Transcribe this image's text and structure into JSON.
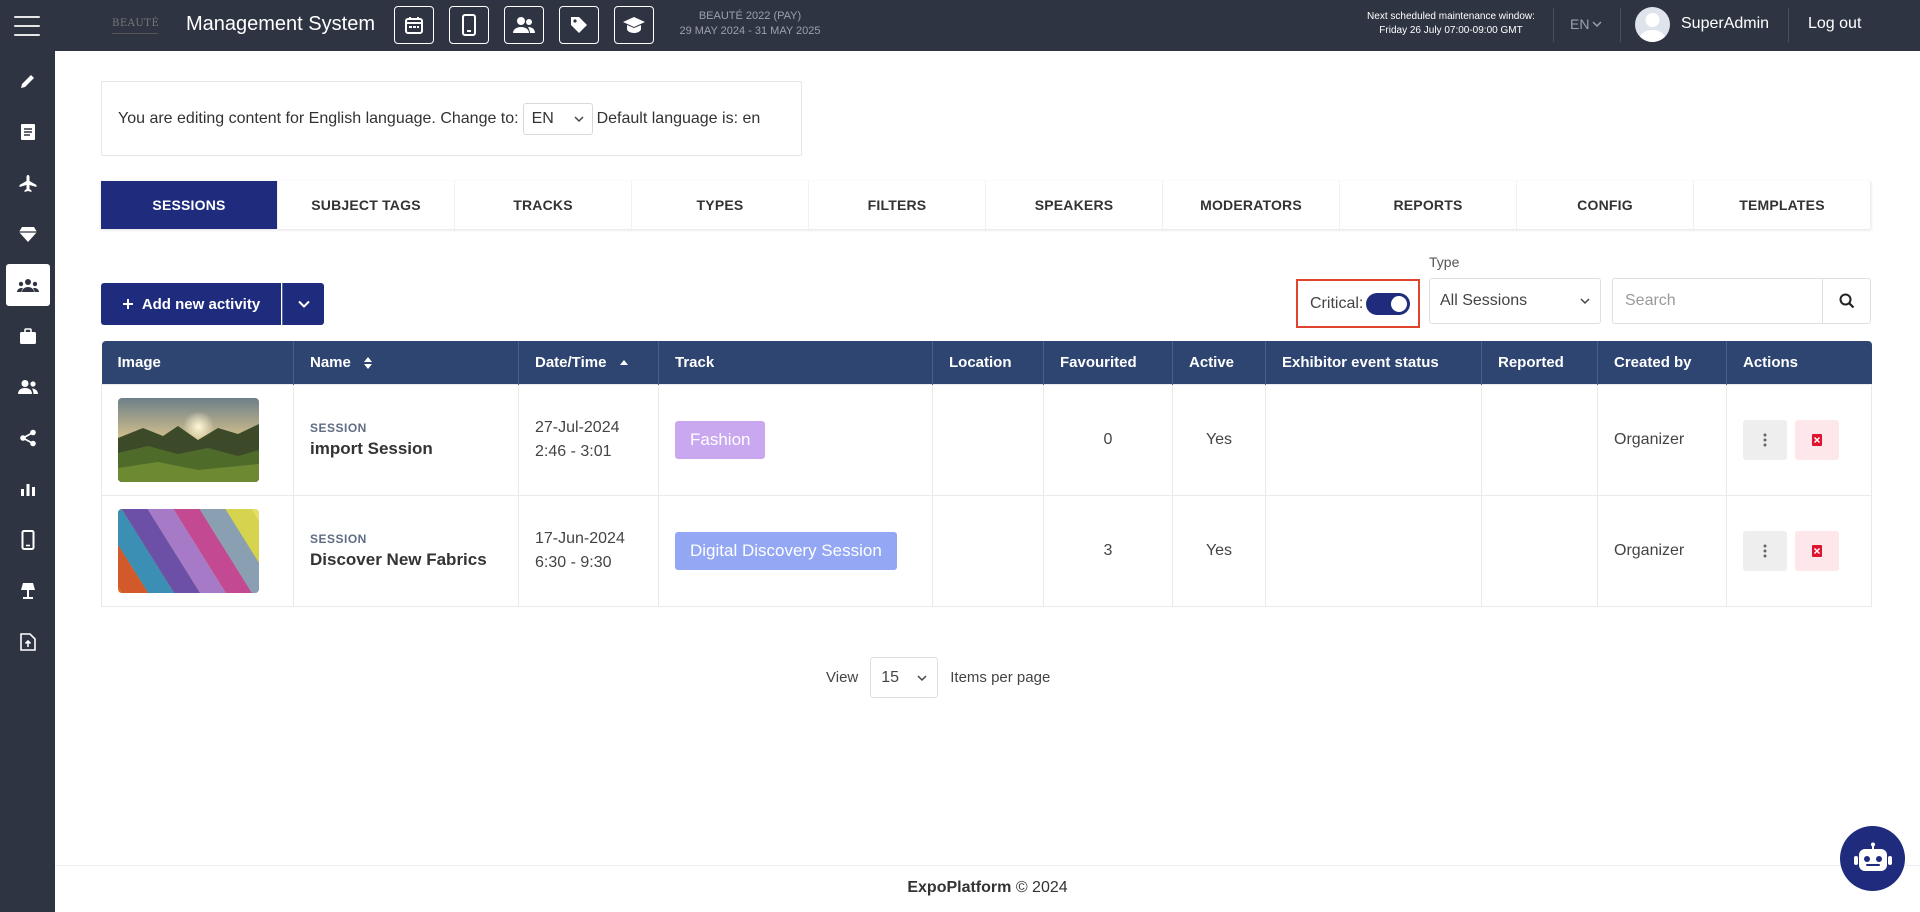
{
  "header": {
    "logo_text": "BEAUTÉ",
    "app_title": "Management System",
    "top_icons": [
      "calendar-icon",
      "mobile-icon",
      "users-icon",
      "tag-icon",
      "graduation-cap-icon"
    ],
    "event_name": "BEAUTÉ 2022 (PAY)",
    "event_dates": "29 MAY 2024 - 31 MAY 2025",
    "maintenance_title": "Next scheduled maintenance window:",
    "maintenance_time": "Friday 26 July 07:00-09:00 GMT",
    "language": "EN",
    "username": "SuperAdmin",
    "logout_label": "Log out"
  },
  "sidebar": {
    "items": [
      "pencil-icon",
      "document-icon",
      "plane-icon",
      "diamond-icon",
      "sessions-icon",
      "briefcase-icon",
      "people-icon",
      "share-icon",
      "bar-chart-icon",
      "mobile-icon",
      "lamp-icon",
      "file-upload-icon"
    ],
    "active_index": 4
  },
  "language_box": {
    "text_before": "You are editing content for English language. Change to:",
    "selected": "EN",
    "text_after": "Default language is: en"
  },
  "tabs": [
    {
      "label": "SESSIONS",
      "active": true
    },
    {
      "label": "SUBJECT TAGS",
      "active": false
    },
    {
      "label": "TRACKS",
      "active": false
    },
    {
      "label": "TYPES",
      "active": false
    },
    {
      "label": "FILTERS",
      "active": false
    },
    {
      "label": "SPEAKERS",
      "active": false
    },
    {
      "label": "MODERATORS",
      "active": false
    },
    {
      "label": "REPORTS",
      "active": false
    },
    {
      "label": "CONFIG",
      "active": false
    },
    {
      "label": "TEMPLATES",
      "active": false
    }
  ],
  "toolbar": {
    "add_label": "Add new activity",
    "critical_label": "Critical:",
    "critical_on": true,
    "type_label": "Type",
    "type_value": "All Sessions",
    "search_placeholder": "Search"
  },
  "table": {
    "columns": [
      "Image",
      "Name",
      "Date/Time",
      "Track",
      "Location",
      "Favourited",
      "Active",
      "Exhibitor event status",
      "Reported",
      "Created by",
      "Actions"
    ],
    "rows": [
      {
        "image": "landscape-sunset-image",
        "type": "SESSION",
        "name": "import Session",
        "date": "27-Jul-2024",
        "time": "2:46 - 3:01",
        "track": "Fashion",
        "track_color": "#c9a8f0",
        "location": "",
        "favourited": "0",
        "active": "Yes",
        "exhibitor_status": "",
        "reported": "",
        "created_by": "Organizer"
      },
      {
        "image": "fabric-rolls-image",
        "type": "SESSION",
        "name": "Discover New Fabrics",
        "date": "17-Jun-2024",
        "time": "6:30 - 9:30",
        "track": "Digital Discovery Session",
        "track_color": "#93a7f5",
        "location": "",
        "favourited": "3",
        "active": "Yes",
        "exhibitor_status": "",
        "reported": "",
        "created_by": "Organizer"
      }
    ]
  },
  "pagination": {
    "view_label": "View",
    "per_page": "15",
    "items_label": "Items per page"
  },
  "footer": {
    "brand": "ExpoPlatform",
    "copyright": "© 2024"
  },
  "colors": {
    "topbar": "#2f3442",
    "primary": "#1f2c7d",
    "table_header": "#2e4572",
    "highlight": "#e0432e"
  }
}
